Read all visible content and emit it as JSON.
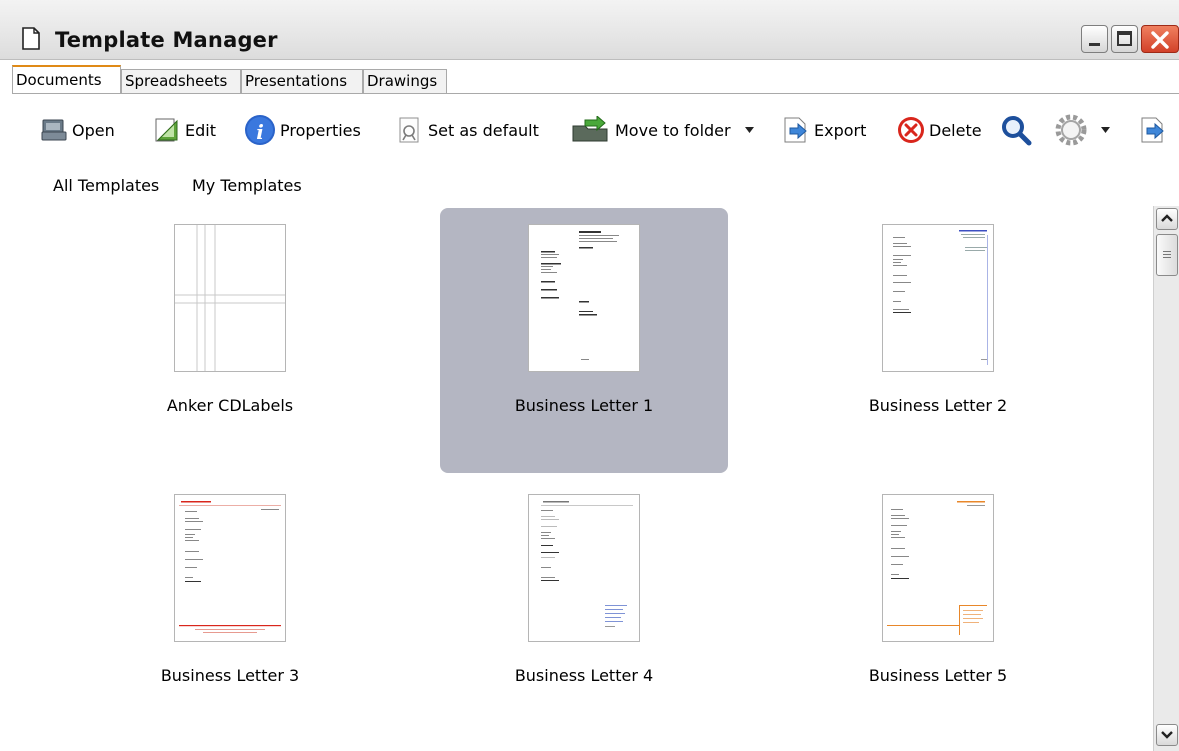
{
  "window": {
    "title": "Template Manager"
  },
  "tabs": [
    {
      "label": "Documents",
      "active": true
    },
    {
      "label": "Spreadsheets",
      "active": false
    },
    {
      "label": "Presentations",
      "active": false
    },
    {
      "label": "Drawings",
      "active": false
    }
  ],
  "toolbar": {
    "open": "Open",
    "edit": "Edit",
    "properties": "Properties",
    "set_default": "Set as default",
    "move_to_folder": "Move to folder",
    "export": "Export",
    "delete": "Delete"
  },
  "filters": {
    "all": "All Templates",
    "mine": "My Templates"
  },
  "templates": [
    {
      "name": "Anker CDLabels",
      "selected": false
    },
    {
      "name": "Business Letter 1",
      "selected": true
    },
    {
      "name": "Business Letter 2",
      "selected": false
    },
    {
      "name": "Business Letter 3",
      "selected": false
    },
    {
      "name": "Business Letter 4",
      "selected": false
    },
    {
      "name": "Business Letter 5",
      "selected": false
    }
  ],
  "icons": [
    "document-icon",
    "minimize-icon",
    "maximize-icon",
    "close-icon",
    "open-folder-icon",
    "edit-icon",
    "info-icon",
    "set-default-icon",
    "move-folder-icon",
    "dropdown-arrow-icon",
    "export-icon",
    "delete-icon",
    "search-icon",
    "gear-icon",
    "more-icon",
    "scroll-up-icon",
    "scroll-down-icon"
  ],
  "colors": {
    "selection": "#b4b6c2",
    "active_tab_accent": "#e08a16",
    "delete_red": "#d9261c",
    "info_blue": "#2a63c9",
    "close_red": "#d2412a"
  }
}
